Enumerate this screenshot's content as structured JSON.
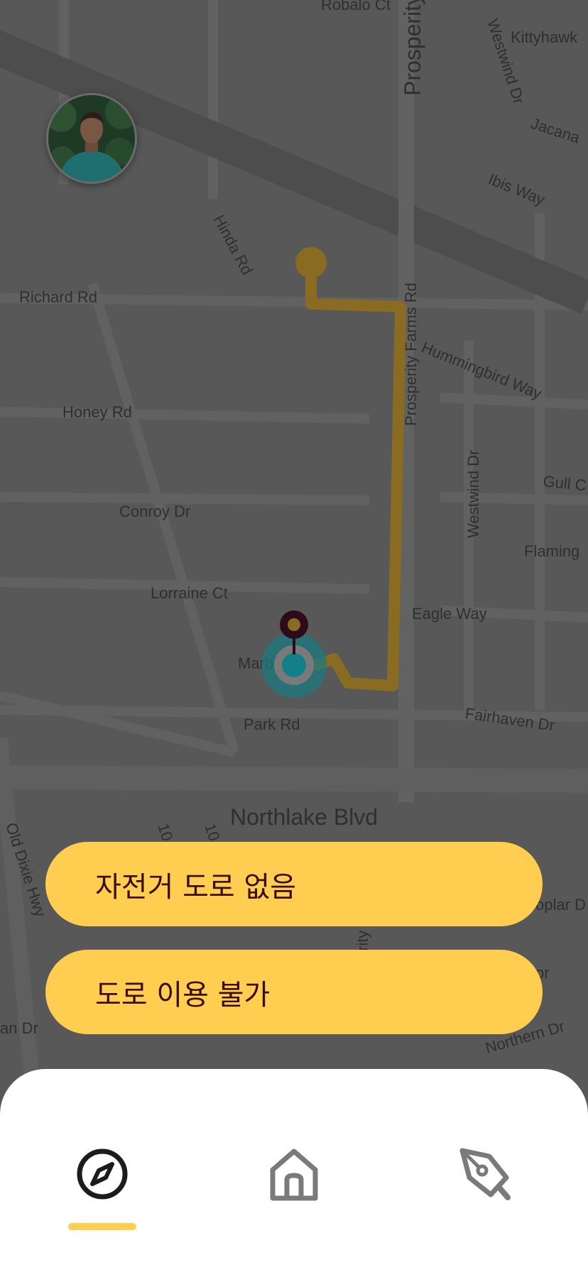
{
  "map": {
    "streets": {
      "robalo_ct": "Robalo Ct",
      "kittyhawk": "Kittyhawk",
      "westwind_dr_top": "Westwind Dr",
      "jacana": "Jacana",
      "prosperity_top": "Prosperity",
      "ibis_way": "Ibis Way",
      "hinda_rd": "Hinda Rd",
      "richard_rd": "Richard Rd",
      "prosperity_farms_rd": "Prosperity Farms Rd",
      "hummingbird_way": "Hummingbird Way",
      "honey_rd": "Honey Rd",
      "westwind_dr": "Westwind Dr",
      "gull_c": "Gull C",
      "conroy_dr": "Conroy Dr",
      "flaming": "Flaming",
      "lorraine_ct": "Lorraine Ct",
      "eagle_way": "Eagle Way",
      "marb": "Marb",
      "park_rd": "Park Rd",
      "fairhaven_dr": "Fairhaven Dr",
      "northlake_blvd": "Northlake Blvd",
      "old_dixie_hwy": "Old Dixie Hwy",
      "ten_a": "10",
      "ten_b": "10",
      "rity": "rity",
      "oplar_d": "oplar D",
      "or": "or",
      "an_dr": "an Dr",
      "northern_dr": "Northern Dr"
    },
    "colors": {
      "route": "#8a6b22",
      "start_dot": "#8a6b22",
      "current_location": "#137f86",
      "destination_pin": "#2d0b1a"
    }
  },
  "profile": {
    "avatar_icon": "user-avatar"
  },
  "actions": {
    "no_bike_lane": "자전거 도로 없음",
    "road_unavailable": "도로 이용 불가"
  },
  "nav": {
    "active_tab": "explore",
    "tabs": [
      {
        "id": "explore",
        "icon": "compass-icon"
      },
      {
        "id": "home",
        "icon": "home-icon"
      },
      {
        "id": "report",
        "icon": "pen-icon"
      }
    ],
    "accent": "#ffcd4f"
  }
}
